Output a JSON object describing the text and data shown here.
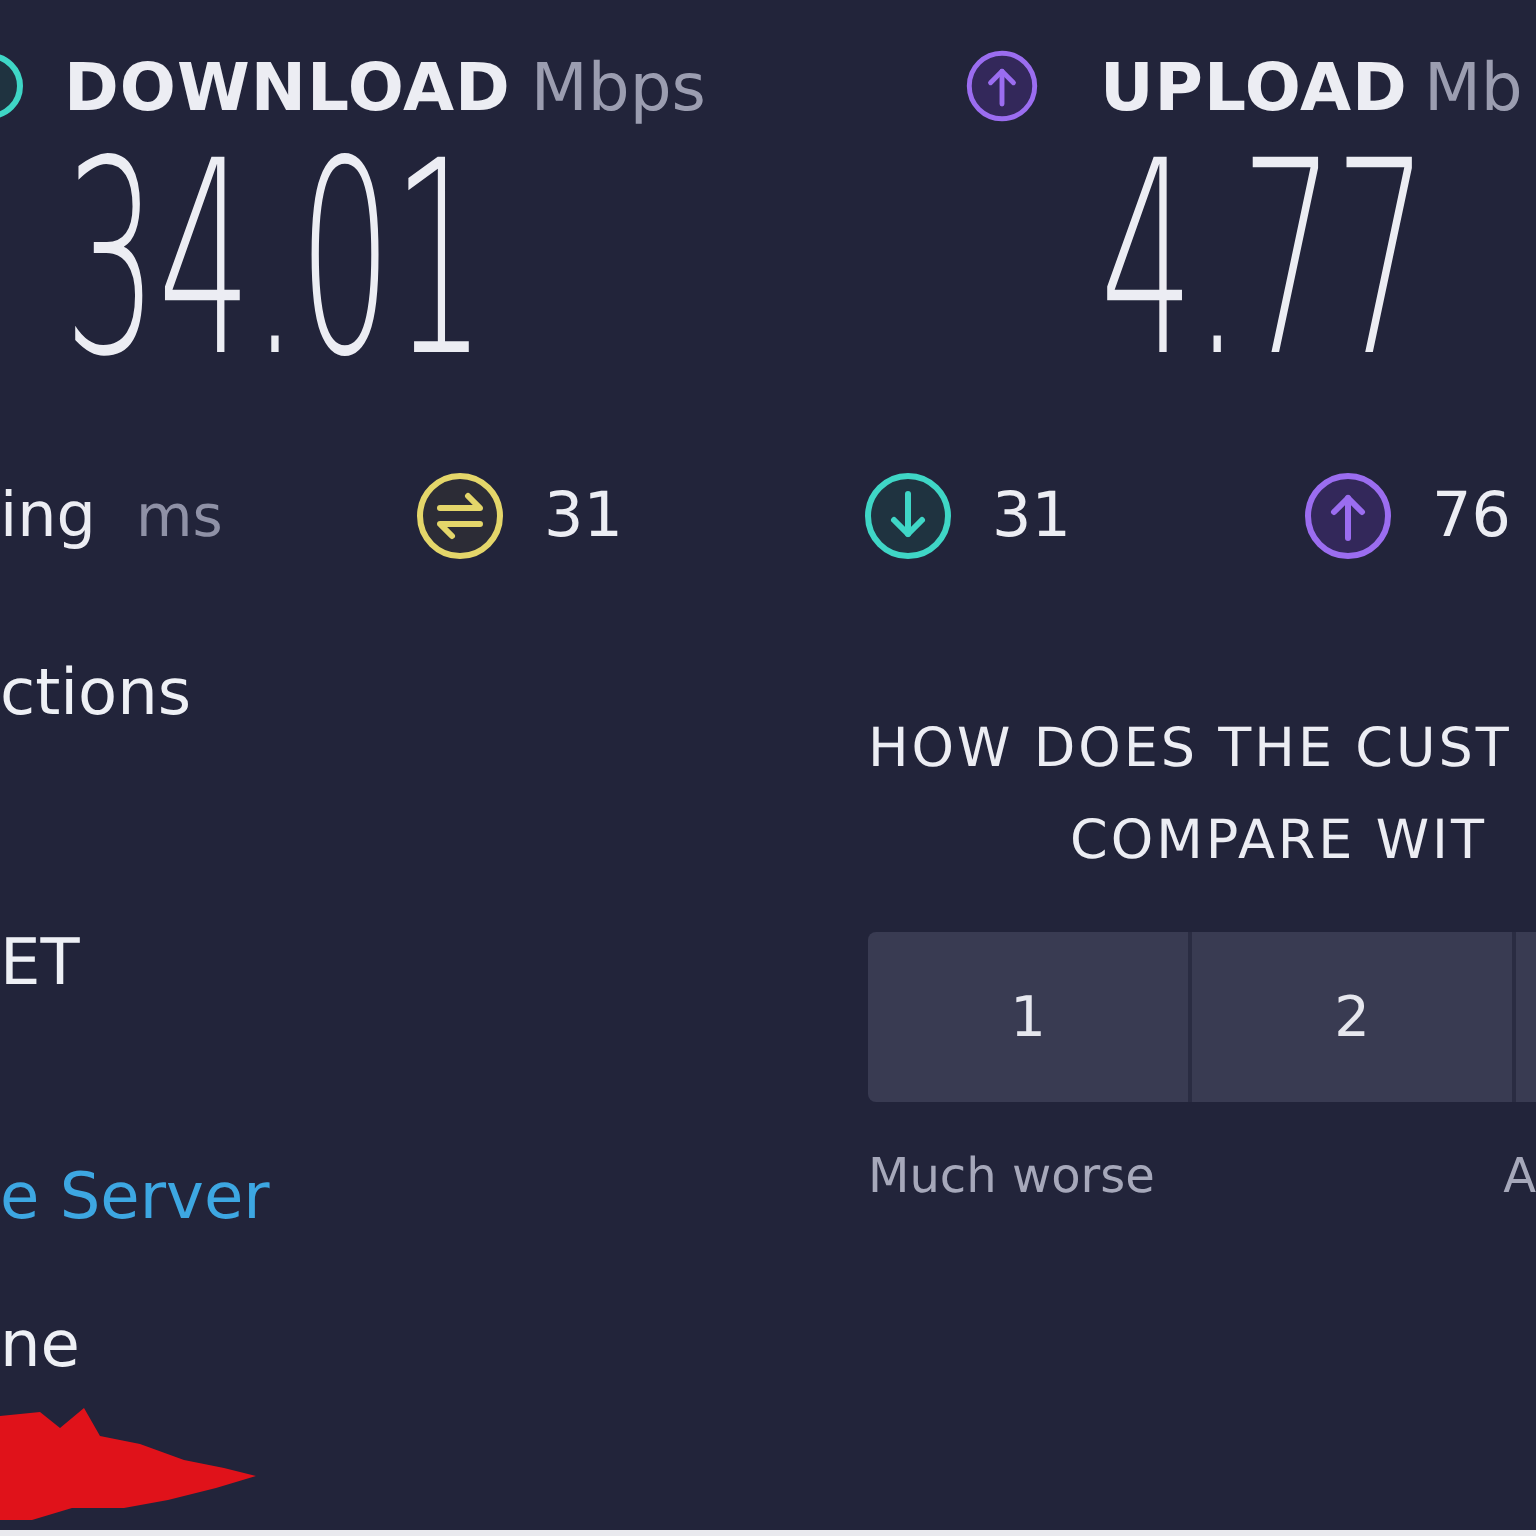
{
  "download": {
    "label": "DOWNLOAD",
    "unit": "Mbps",
    "value": "34.01"
  },
  "upload": {
    "label": "UPLOAD",
    "unit": "Mb",
    "value": "4.77"
  },
  "metrics": [
    {
      "kind": "ping",
      "label": "ing",
      "unit": "ms"
    },
    {
      "kind": "jitter",
      "value": "31"
    },
    {
      "kind": "download",
      "value": "31"
    },
    {
      "kind": "upload",
      "value": "76"
    }
  ],
  "details": [
    {
      "kind": "text",
      "text": "ctions"
    },
    {
      "kind": "text",
      "text": "ET"
    },
    {
      "kind": "link",
      "text": "e Server"
    },
    {
      "kind": "text",
      "text": "ne"
    }
  ],
  "survey": {
    "question_lines": [
      "HOW DOES THE CUST",
      "COMPARE WIT"
    ],
    "ratings": [
      {
        "label": "1"
      },
      {
        "label": "2"
      }
    ],
    "scale_labels": [
      "Much worse",
      "A"
    ]
  }
}
